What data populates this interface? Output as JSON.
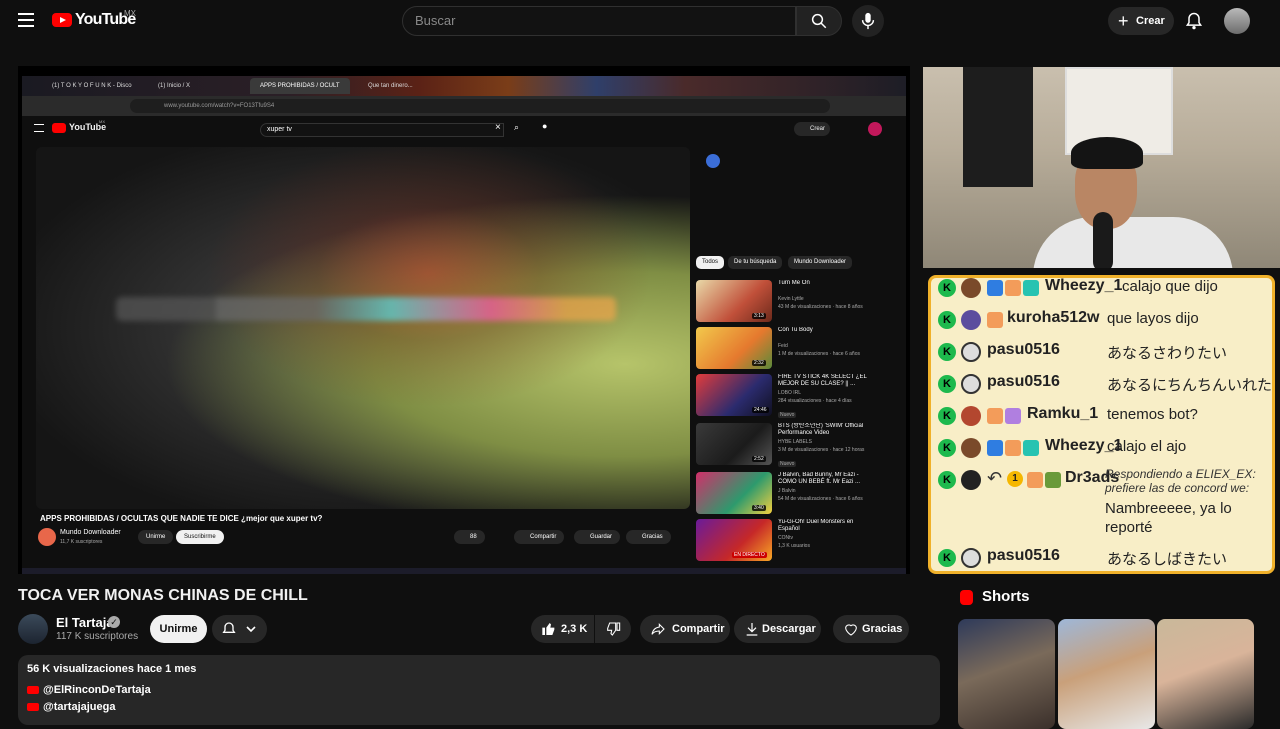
{
  "header": {
    "logo_text": "YouTube",
    "country": "MX",
    "search_placeholder": "Buscar",
    "create_label": "Crear"
  },
  "embedded": {
    "tabs": [
      "(1) T O K Y O  F U N K - Disco",
      "(1) Inicio / X",
      "APPS PROHIBIDAS / OCULT",
      "Que tan dinero..."
    ],
    "url": "www.youtube.com/watch?v=FO13Tfu9S4",
    "country": "MX",
    "search_value": "xuper tv",
    "create_label": "Crear",
    "chips": [
      "Todos",
      "De tu búsqueda",
      "Mundo Downloader"
    ],
    "recommendations": [
      {
        "title": "Turn Me On",
        "channel": "Kevin Lyttle",
        "meta": "43 M de visualizaciones · hace 8 años",
        "duration": "3:13",
        "badge": ""
      },
      {
        "title": "Con Tu Body",
        "channel": "Feid",
        "meta": "1 M de visualizaciones · hace 6 años",
        "duration": "2:32",
        "badge": ""
      },
      {
        "title": "FIRE TV STICK 4K SELECT ¿EL MEJOR DE SU CLASE? || ...",
        "channel": "LOBO IRL",
        "meta": "284 visualizaciones · hace 4 días",
        "duration": "24:46",
        "badge": "Nuevo"
      },
      {
        "title": "BTS (방탄소년단) 'SWIM' Official Performance Video",
        "channel": "HYBE LABELS",
        "meta": "3 M de visualizaciones · hace 12 horas",
        "duration": "2:52",
        "badge": "Nuevo"
      },
      {
        "title": "J Balvin, Bad Bunny, Mr Eazi - COMO UN BEBÉ ft. Mr Eazi ...",
        "channel": "J Balvin",
        "meta": "54 M de visualizaciones · hace 6 años",
        "duration": "3:40",
        "badge": ""
      },
      {
        "title": "Yu-Gi-Oh! Duel Monsters en Español",
        "channel": "CONtv",
        "meta": "1,3 K usuarios",
        "duration": "EN DIRECTO",
        "badge": ""
      },
      {
        "title": "Alex Rose ft. Cazzu, Lenny Tavarez, Lyanno & Rauw ...",
        "channel": "Alex Rose",
        "meta": "192M M de visualizaciones · hace 7 años",
        "duration": "6:19",
        "badge": ""
      }
    ],
    "video_title": "APPS PROHIBIDAS / OCULTAS QUE NADIE TE DICE ¿mejor que xuper tv?",
    "channel": "Mundo Downloader",
    "subs": "11,7 K suscriptores",
    "join": "Unirme",
    "subscribe": "Suscribirme",
    "likes": "88",
    "share": "Compartir",
    "save": "Guardar",
    "thanks": "Gracias",
    "taskbar_search": "Buscar",
    "clock": "09:50 p. m. 24/03/2026"
  },
  "chat": {
    "messages": [
      {
        "user": "Wheezy_1",
        "text": "calajo que dijo"
      },
      {
        "user": "kuroha512w",
        "text": "que layos dijo"
      },
      {
        "user": "pasu0516",
        "text": "あなるさわりたい"
      },
      {
        "user": "pasu0516",
        "text": "あなるにちんちんいれたい"
      },
      {
        "user": "Ramku_1",
        "text": "tenemos bot?"
      },
      {
        "user": "Wheezy_1",
        "text": "calajo el ajo"
      },
      {
        "user": "Dr3ads",
        "reply_to": "Respondiendo a ELIEX_EX: prefiere las de concord we:",
        "text": "Nambreeeee, ya lo reporté",
        "badge_count": "1"
      },
      {
        "user": "pasu0516",
        "text": "あなるしばきたい"
      }
    ]
  },
  "video": {
    "title": "TOCA VER MONAS CHINAS DE CHILL",
    "channel": "El Tartaja",
    "subscribers": "117 K suscriptores",
    "join_label": "Unirme",
    "likes": "2,3 K",
    "share_label": "Compartir",
    "download_label": "Descargar",
    "thanks_label": "Gracias",
    "description": {
      "meta": "56 K visualizaciones  hace 1 mes",
      "links": [
        "@ElRinconDeTartaja",
        "@tartajajuega"
      ]
    }
  },
  "shorts": {
    "title": "Shorts"
  },
  "colors": {
    "brand_red": "#ff0000",
    "chat_border": "#f0b12a",
    "chat_bg": "#f8eec7",
    "kick_green": "#1db94d"
  }
}
